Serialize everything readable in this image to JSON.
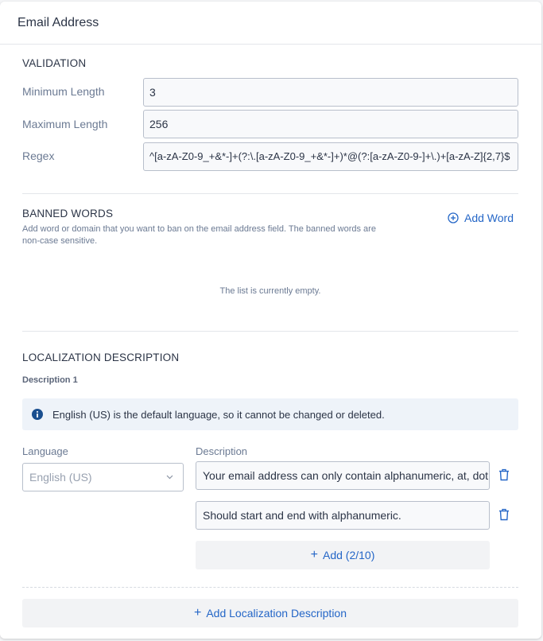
{
  "header": {
    "title": "Email Address"
  },
  "validation": {
    "section_title": "VALIDATION",
    "min_length": {
      "label": "Minimum Length",
      "value": "3"
    },
    "max_length": {
      "label": "Maximum Length",
      "value": "256"
    },
    "regex": {
      "label": "Regex",
      "value": "^[a-zA-Z0-9_+&*-]+(?:\\.[a-zA-Z0-9_+&*-]+)*@(?:[a-zA-Z0-9-]+\\.)+[a-zA-Z]{2,7}$"
    }
  },
  "banned_words": {
    "section_title": "BANNED WORDS",
    "helper": "Add word or domain that you want to ban on the email address field. The banned words are non-case sensitive.",
    "add_label": "Add Word",
    "empty_text": "The list is currently empty."
  },
  "localization": {
    "section_title": "LOCALIZATION DESCRIPTION",
    "description_label": "Description 1",
    "info_text": "English (US) is the default language, so it cannot be changed or deleted.",
    "language_label": "Language",
    "language_value": "English (US)",
    "description_col_label": "Description",
    "descriptions": [
      "Your email address can only contain alphanumeric, at, dot, underscore, dash, plus, ampersand and asterisk.",
      "Should start and end with alphanumeric."
    ],
    "add_label": "Add (2/10)",
    "add_localization_label": "Add Localization Description"
  },
  "colors": {
    "accent": "#2466c7",
    "info_icon": "#1a4f8f",
    "banner_bg": "#eef3f9"
  }
}
